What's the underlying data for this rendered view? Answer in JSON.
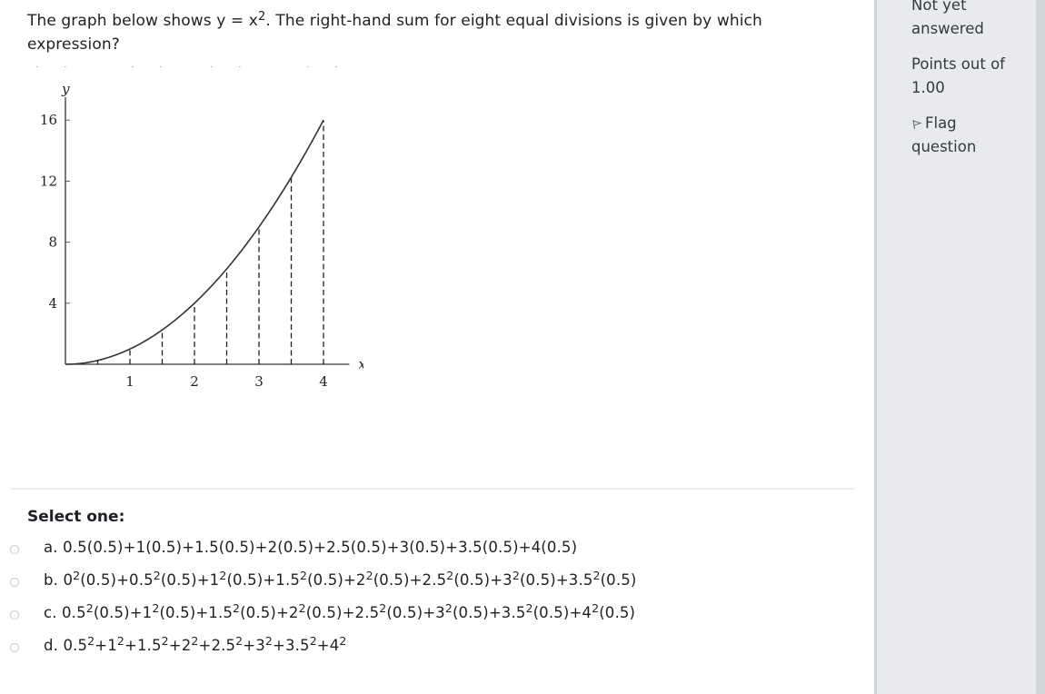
{
  "question": {
    "text_before_sup": "The graph below shows y = x",
    "sup": "2",
    "text_after_sup": ". The right-hand sum for eight equal divisions is given by which expression?"
  },
  "chart_data": {
    "type": "line",
    "title": "",
    "function": "y = x^2",
    "xlabel": "x",
    "ylabel": "y",
    "xlim": [
      0,
      4.4
    ],
    "ylim": [
      0,
      17.5
    ],
    "x_ticks": [
      1,
      2,
      3,
      4
    ],
    "x_tick_labels": [
      "1",
      "2",
      "3",
      "4"
    ],
    "y_ticks": [
      4,
      8,
      12,
      16
    ],
    "y_tick_labels": [
      "4",
      "8",
      "12",
      "16"
    ],
    "grid": false,
    "curve_x_range": [
      0,
      4
    ],
    "dashed_lines_at_x": [
      0.5,
      1,
      1.5,
      2,
      2.5,
      3,
      3.5,
      4
    ],
    "dashed_lines_y": [
      0.25,
      1,
      2.25,
      4,
      6.25,
      9,
      12.25,
      16
    ]
  },
  "prompt": "Select one:",
  "answers": [
    {
      "letter": "a.",
      "parts": [
        {
          "t": "0.5(0.5)+1(0.5)+1.5(0.5)+2(0.5)+2.5(0.5)+3(0.5)+3.5(0.5)+4(0.5)"
        }
      ]
    },
    {
      "letter": "b.",
      "parts": [
        {
          "t": "0"
        },
        {
          "s": "2"
        },
        {
          "t": "(0.5)+0.5"
        },
        {
          "s": "2"
        },
        {
          "t": "(0.5)+1"
        },
        {
          "s": "2"
        },
        {
          "t": "(0.5)+1.5"
        },
        {
          "s": "2"
        },
        {
          "t": "(0.5)+2"
        },
        {
          "s": "2"
        },
        {
          "t": "(0.5)+2.5"
        },
        {
          "s": "2"
        },
        {
          "t": "(0.5)+3"
        },
        {
          "s": "2"
        },
        {
          "t": "(0.5)+3.5"
        },
        {
          "s": "2"
        },
        {
          "t": "(0.5)"
        }
      ]
    },
    {
      "letter": "c.",
      "parts": [
        {
          "t": "0.5"
        },
        {
          "s": "2"
        },
        {
          "t": "(0.5)+1"
        },
        {
          "s": "2"
        },
        {
          "t": "(0.5)+1.5"
        },
        {
          "s": "2"
        },
        {
          "t": "(0.5)+2"
        },
        {
          "s": "2"
        },
        {
          "t": "(0.5)+2.5"
        },
        {
          "s": "2"
        },
        {
          "t": "(0.5)+3"
        },
        {
          "s": "2"
        },
        {
          "t": "(0.5)+3.5"
        },
        {
          "s": "2"
        },
        {
          "t": "(0.5)+4"
        },
        {
          "s": "2"
        },
        {
          "t": "(0.5)"
        }
      ]
    },
    {
      "letter": "d.",
      "parts": [
        {
          "t": "0.5"
        },
        {
          "s": "2"
        },
        {
          "t": "+1"
        },
        {
          "s": "2"
        },
        {
          "t": "+1.5"
        },
        {
          "s": "2"
        },
        {
          "t": "+2"
        },
        {
          "s": "2"
        },
        {
          "t": "+2.5"
        },
        {
          "s": "2"
        },
        {
          "t": "+3"
        },
        {
          "s": "2"
        },
        {
          "t": "+3.5"
        },
        {
          "s": "2"
        },
        {
          "t": "+4"
        },
        {
          "s": "2"
        }
      ]
    }
  ],
  "sidebar": {
    "state": "Not yet answered",
    "grade": "Points out of 1.00",
    "flag_label": "Flag question",
    "flag_icon": "flag-icon"
  }
}
